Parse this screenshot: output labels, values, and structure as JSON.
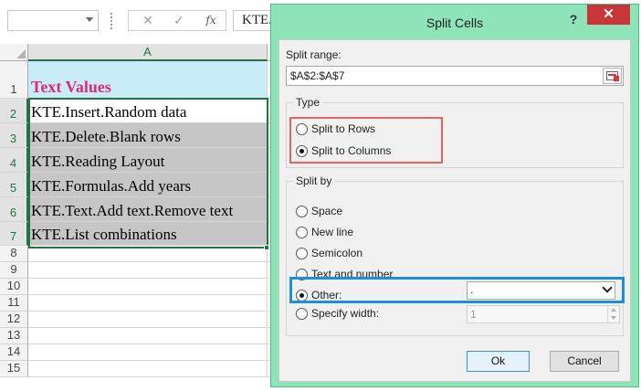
{
  "formula_bar": {
    "name_box_value": "",
    "cancel_glyph": "✕",
    "enter_glyph": "✓",
    "fx_label": "fx",
    "formula_text": "KTE.Insert.Random data"
  },
  "sheet": {
    "column_header": "A",
    "rows": [
      {
        "num": "1",
        "text": "Text Values"
      },
      {
        "num": "2",
        "text": "KTE.Insert.Random data"
      },
      {
        "num": "3",
        "text": "KTE.Delete.Blank rows"
      },
      {
        "num": "4",
        "text": "KTE.Reading Layout"
      },
      {
        "num": "5",
        "text": "KTE.Formulas.Add years"
      },
      {
        "num": "6",
        "text": "KTE.Text.Add text.Remove text"
      },
      {
        "num": "7",
        "text": "KTE.List combinations"
      },
      {
        "num": "8",
        "text": ""
      },
      {
        "num": "9",
        "text": ""
      },
      {
        "num": "10",
        "text": ""
      },
      {
        "num": "11",
        "text": ""
      },
      {
        "num": "12",
        "text": ""
      },
      {
        "num": "13",
        "text": ""
      },
      {
        "num": "14",
        "text": ""
      },
      {
        "num": "15",
        "text": ""
      }
    ]
  },
  "dialog": {
    "title": "Split Cells",
    "help_label": "?",
    "close_label": "✕",
    "split_range_label": "Split range:",
    "split_range_value": "$A$2:$A$7",
    "type_group_title": "Type",
    "type_options": [
      "Split to Rows",
      "Split to Columns"
    ],
    "type_selected": "Split to Columns",
    "split_by_group_title": "Split by",
    "split_by_options": [
      "Space",
      "New line",
      "Semicolon",
      "Text and number",
      "Other:",
      "Specify width:"
    ],
    "split_by_selected": "Other:",
    "other_value": ".",
    "width_value": "1",
    "ok_label": "Ok",
    "cancel_label": "Cancel"
  },
  "colors": {
    "dialog_frame": "#8fe3b8",
    "close_button": "#c8363a",
    "excel_green": "#217346",
    "header_fill": "#c9ecf9",
    "header_text": "#e0287a",
    "selection_fill": "#c6c6c6",
    "highlight_red": "#e06567",
    "highlight_blue": "#1c8fd6"
  }
}
